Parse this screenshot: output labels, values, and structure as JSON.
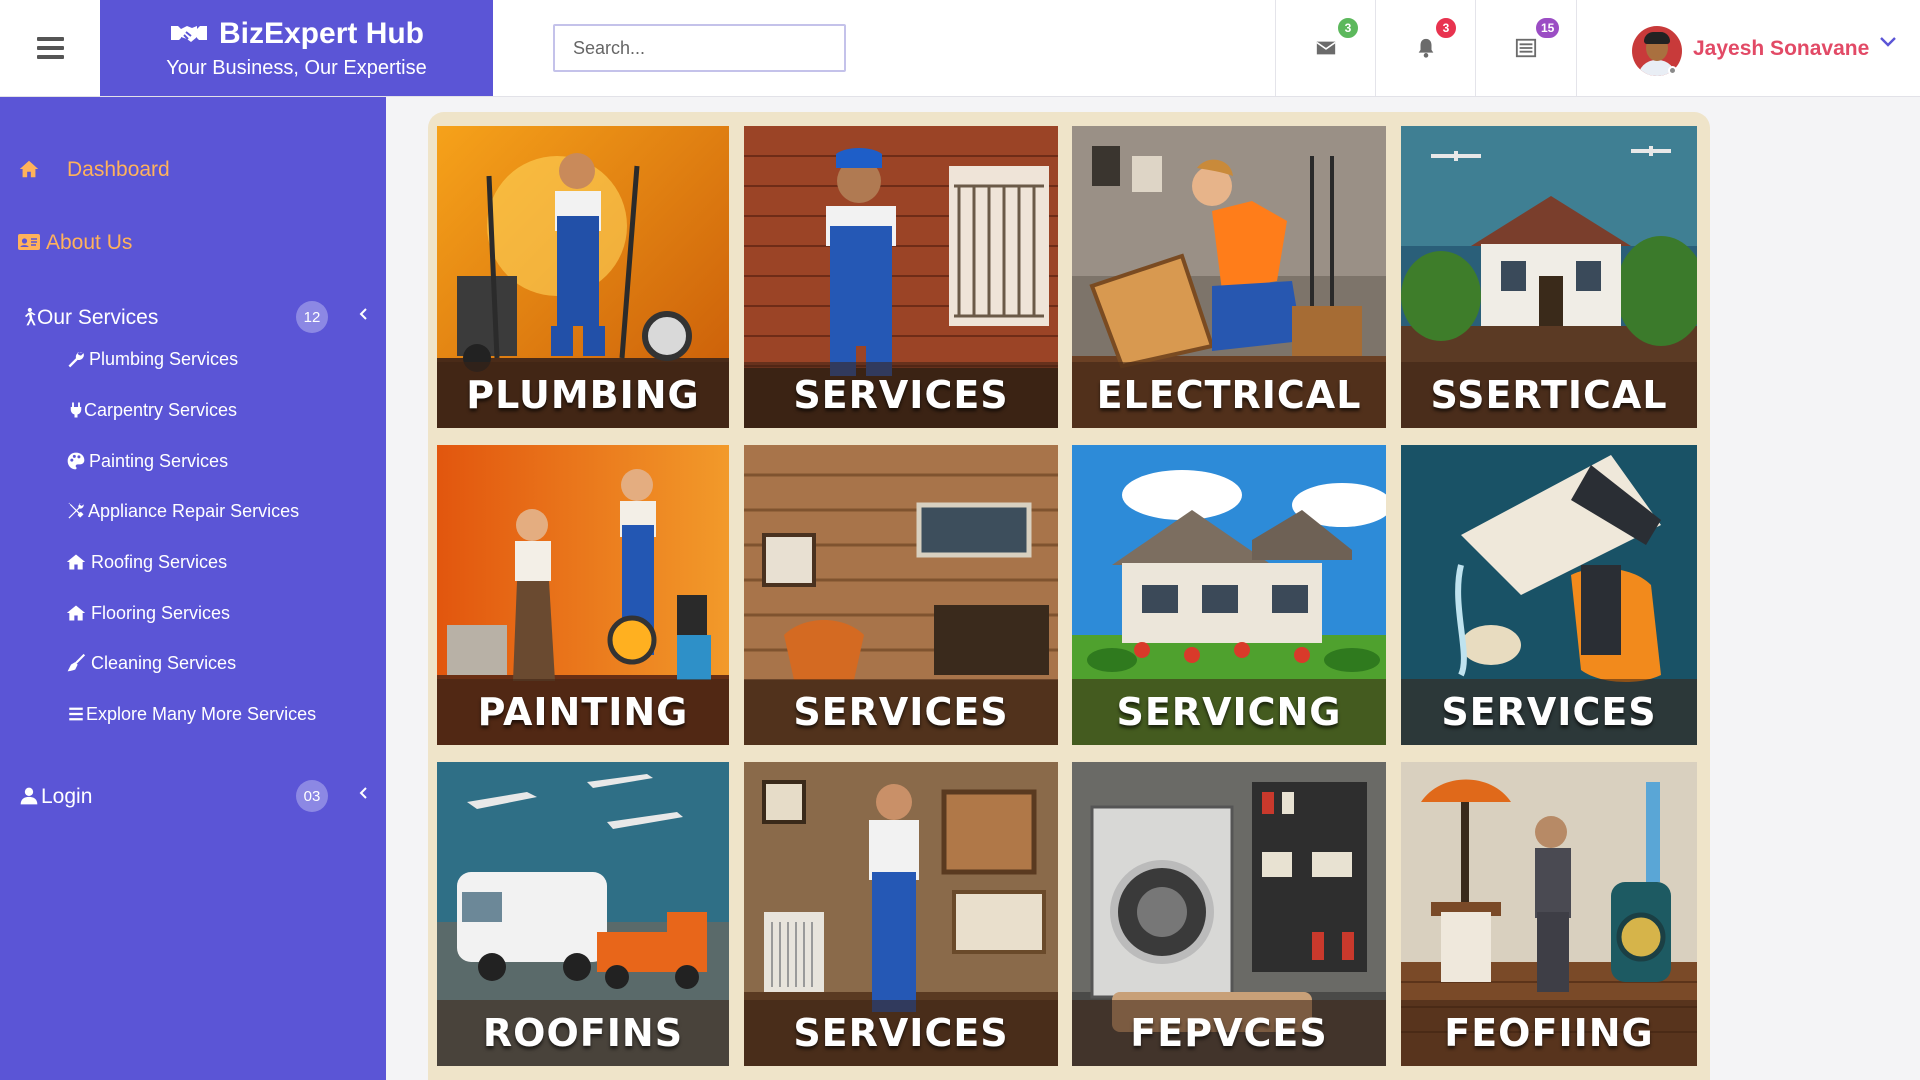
{
  "header": {
    "brand_title": "BizExpert Hub",
    "brand_tagline": "Your Business, Our Expertise",
    "search_placeholder": "Search...",
    "messages_count": "3",
    "notifications_count": "3",
    "tasks_count": "15",
    "user_name": "Jayesh Sonavane"
  },
  "sidebar": {
    "dashboard": "Dashboard",
    "about": "About Us",
    "services": "Our Services",
    "services_count": "12",
    "service_items": [
      "Plumbing Services",
      "Carpentry Services",
      "Painting Services",
      "Appliance Repair Services",
      "Roofing Services",
      "Flooring Services",
      "Cleaning Services",
      "Explore Many More Services"
    ],
    "login": "Login",
    "login_count": "03"
  },
  "tiles": [
    {
      "caption": "PLUMBING",
      "scene": "plumber-with-tools"
    },
    {
      "caption": "SERVICES",
      "scene": "worker-brick-wall"
    },
    {
      "caption": "ELECTRICAL",
      "scene": "electrician-workshop"
    },
    {
      "caption": "SSERTICAL",
      "scene": "house-with-drones"
    },
    {
      "caption": "PAINTING",
      "scene": "painters-orange"
    },
    {
      "caption": "SERVICES",
      "scene": "carpentry-wall"
    },
    {
      "caption": "SERVICNG",
      "scene": "house-garden"
    },
    {
      "caption": "SERVICES",
      "scene": "hand-with-tool"
    },
    {
      "caption": "ROOFINS",
      "scene": "vans-and-planes"
    },
    {
      "caption": "SERVICES",
      "scene": "repairman-cabinet"
    },
    {
      "caption": "FEPVCES",
      "scene": "laundry-room"
    },
    {
      "caption": "FEOFIING",
      "scene": "man-with-lamp"
    }
  ],
  "colors": {
    "brand": "#5b55d6",
    "accent_orange": "#ffb25b",
    "user_name": "#e24a66",
    "badge_green": "#5cb85c",
    "badge_red": "#e8334f",
    "badge_purple": "#9b4dc4"
  }
}
